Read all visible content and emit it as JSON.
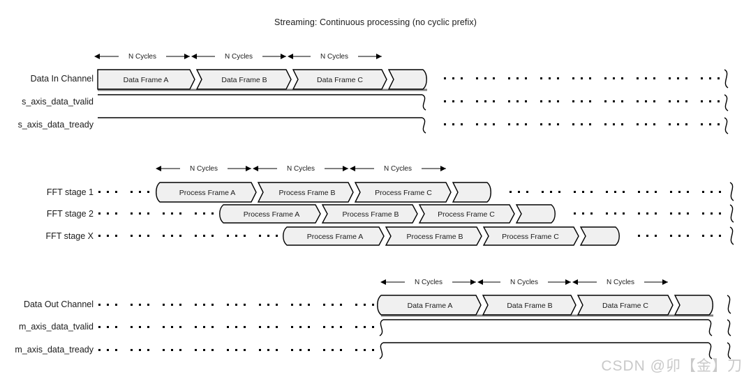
{
  "title": "Streaming: Continuous processing (no cyclic prefix)",
  "watermark": "CSDN @卯【金】刀",
  "labels": {
    "n_cycles": "N Cycles"
  },
  "colors": {
    "box_fill": "#f0f0f0",
    "box_stroke": "#000000",
    "shadow": "#808080",
    "text": "#1a1a1a",
    "background": "#ffffff",
    "watermark": "#c9c9c9"
  },
  "sections": [
    {
      "name": "input-section",
      "rows": [
        {
          "label": "Data In Channel",
          "type": "data",
          "frames": [
            "Data Frame A",
            "Data Frame B",
            "Data Frame C",
            ""
          ]
        },
        {
          "label": "s_axis_data_tvalid",
          "type": "level",
          "frames": []
        },
        {
          "label": "s_axis_data_tready",
          "type": "level",
          "frames": []
        }
      ],
      "n_cycles_markers": 3
    },
    {
      "name": "fft-section",
      "rows": [
        {
          "label": "FFT stage 1",
          "type": "data",
          "frames": [
            "Process Frame A",
            "Process Frame B",
            "Process Frame C",
            ""
          ]
        },
        {
          "label": "FFT stage 2",
          "type": "data",
          "frames": [
            "Process Frame A",
            "Process Frame B",
            "Process Frame C",
            ""
          ]
        },
        {
          "label": "FFT stage X",
          "type": "data",
          "frames": [
            "Process Frame A",
            "Process Frame B",
            "Process Frame C",
            ""
          ]
        }
      ],
      "n_cycles_markers": 3
    },
    {
      "name": "output-section",
      "rows": [
        {
          "label": "Data Out Channel",
          "type": "data",
          "frames": [
            "Data Frame A",
            "Data Frame B",
            "Data Frame C",
            ""
          ]
        },
        {
          "label": "m_axis_data_tvalid",
          "type": "level",
          "frames": []
        },
        {
          "label": "m_axis_data_tready",
          "type": "level",
          "frames": []
        }
      ],
      "n_cycles_markers": 3
    }
  ]
}
